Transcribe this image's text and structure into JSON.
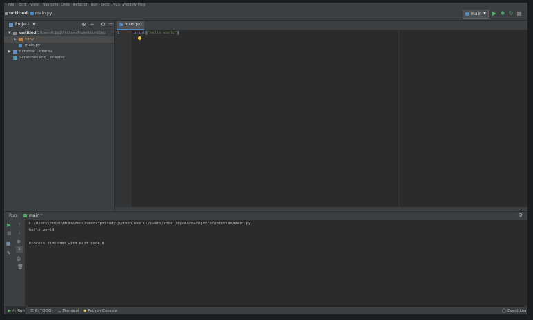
{
  "menu": [
    "File",
    "Edit",
    "View",
    "Navigate",
    "Code",
    "Refactor",
    "Run",
    "Tools",
    "VCS",
    "Window",
    "Help"
  ],
  "breadcrumb": {
    "project": "untitled",
    "file": "main.py"
  },
  "run_config": {
    "label": "main"
  },
  "project_panel": {
    "title": "Project",
    "tree": {
      "root": {
        "label": "untitled",
        "path": "C:\\Users\\rtbo1\\PycharmProjects\\untitled"
      },
      "venv": "venv",
      "file": "main.py",
      "external": "External Libraries",
      "scratches": "Scratches and Consoles"
    }
  },
  "editor": {
    "tab_label": "main.py",
    "line_number": "1",
    "code": {
      "func": "print",
      "open": "(",
      "string": "\"hello world\"",
      "close": ")"
    }
  },
  "run_panel": {
    "title": "Run:",
    "tab_label": "main",
    "console_lines": [
      "C:\\Users\\rtbo1\\Miniconda3\\envs\\pyStudy\\python.exe C:/Users/rtbo1/PycharmProjects/untitled/main.py",
      "hello world",
      "",
      "Process finished with exit code 0"
    ]
  },
  "status_bar": {
    "run": "4: Run",
    "todo": "6: TODO",
    "terminal": "Terminal",
    "python_console": "Python Console",
    "event_log": "Event Log"
  },
  "colors": {
    "accent": "#4a88c7",
    "run_green": "#59a869",
    "string_green": "#6a8759",
    "folder_orange": "#c07a3a",
    "bulb_yellow": "#e8c34a"
  }
}
